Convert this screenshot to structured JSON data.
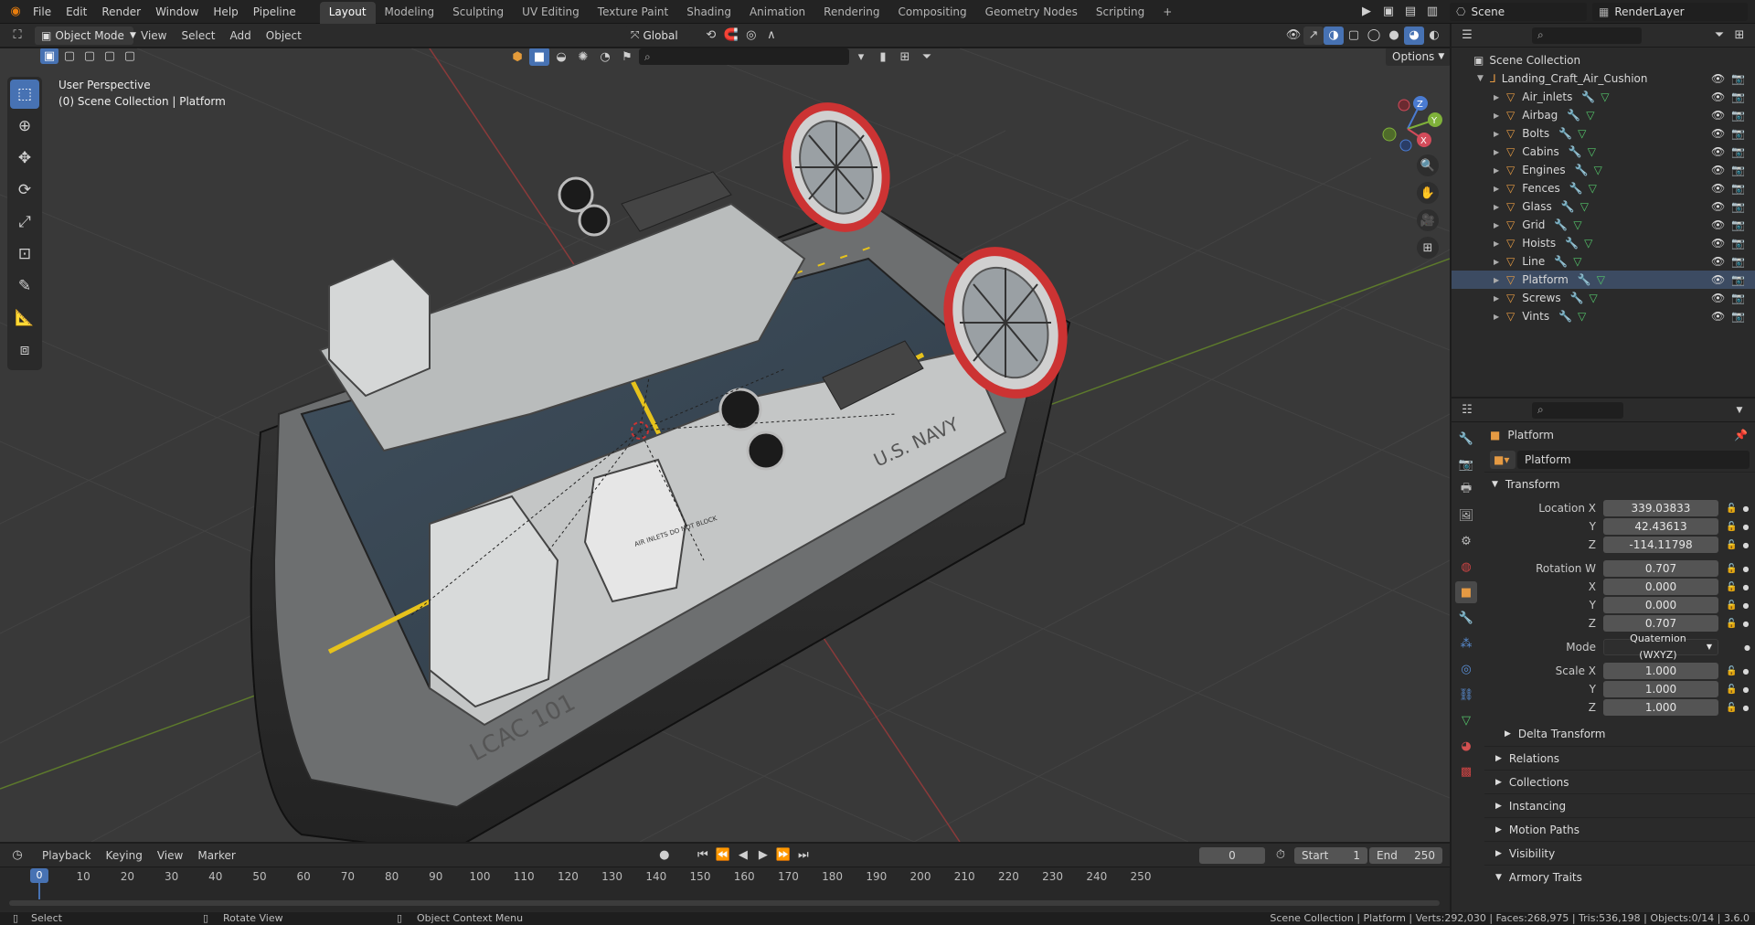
{
  "topbar": {
    "menus": [
      "File",
      "Edit",
      "Render",
      "Window",
      "Help",
      "Pipeline"
    ],
    "workspaces": [
      "Layout",
      "Modeling",
      "Sculpting",
      "UV Editing",
      "Texture Paint",
      "Shading",
      "Animation",
      "Rendering",
      "Compositing",
      "Geometry Nodes",
      "Scripting"
    ],
    "active_workspace": "Layout",
    "add_tab": "+",
    "scene_name": "Scene",
    "view_layer": "RenderLayer"
  },
  "viewport_header": {
    "mode": "Object Mode",
    "menus": [
      "View",
      "Select",
      "Add",
      "Object"
    ],
    "orientation": "Global",
    "options_label": "Options"
  },
  "viewport": {
    "view_name": "User Perspective",
    "view_context": "(0) Scene Collection | Platform",
    "hull_markings": [
      "U.S. NAVY",
      "LCAC 101",
      "AIR INLETS DO NOT BLOCK"
    ],
    "gizmo_axes": [
      "Z",
      "Y",
      "X"
    ],
    "tools": [
      "select-box",
      "cursor",
      "move",
      "rotate",
      "scale",
      "transform",
      "annotate",
      "measure",
      "add-cube"
    ]
  },
  "outliner": {
    "root": "Scene Collection",
    "collection": "Landing_Craft_Air_Cushion",
    "items": [
      "Air_inlets",
      "Airbag",
      "Bolts",
      "Cabins",
      "Engines",
      "Fences",
      "Glass",
      "Grid",
      "Hoists",
      "Line",
      "Platform",
      "Screws",
      "Vints"
    ],
    "selected": "Platform"
  },
  "properties": {
    "object_name": "Platform",
    "data_name": "Platform",
    "transform_title": "Transform",
    "location": {
      "label": "Location X",
      "x": "339.03833",
      "y": "42.43613",
      "z": "-114.11798"
    },
    "rotation": {
      "label": "Rotation W",
      "w": "0.707",
      "x": "0.000",
      "y": "0.000",
      "z": "0.707"
    },
    "mode": {
      "label": "Mode",
      "value": "Quaternion (WXYZ)"
    },
    "scale": {
      "label": "Scale X",
      "x": "1.000",
      "y": "1.000",
      "z": "1.000"
    },
    "axis_labels": {
      "x": "X",
      "y": "Y",
      "z": "Z"
    },
    "sections": [
      "Delta Transform",
      "Relations",
      "Collections",
      "Instancing",
      "Motion Paths",
      "Visibility",
      "Armory Traits"
    ]
  },
  "timeline": {
    "menus": [
      "Playback",
      "Keying",
      "View",
      "Marker"
    ],
    "current_frame": "0",
    "start_label": "Start",
    "start": "1",
    "end_label": "End",
    "end": "250",
    "ticks": [
      "0",
      "10",
      "20",
      "30",
      "40",
      "50",
      "60",
      "70",
      "80",
      "90",
      "100",
      "110",
      "120",
      "130",
      "140",
      "150",
      "160",
      "170",
      "180",
      "190",
      "200",
      "210",
      "220",
      "230",
      "240",
      "250"
    ],
    "playhead": "0"
  },
  "statusbar": {
    "left_select": "Select",
    "rotate": "Rotate View",
    "context": "Object Context Menu",
    "stats": "Scene Collection | Platform | Verts:292,030 | Faces:268,975 | Tris:536,198 | Objects:0/14 | 3.6.0"
  },
  "colors": {
    "accent": "#4772b3",
    "selected_row": "#3c4b62",
    "object_orange": "#e59a43",
    "deck_yellow": "#e6c21c"
  }
}
